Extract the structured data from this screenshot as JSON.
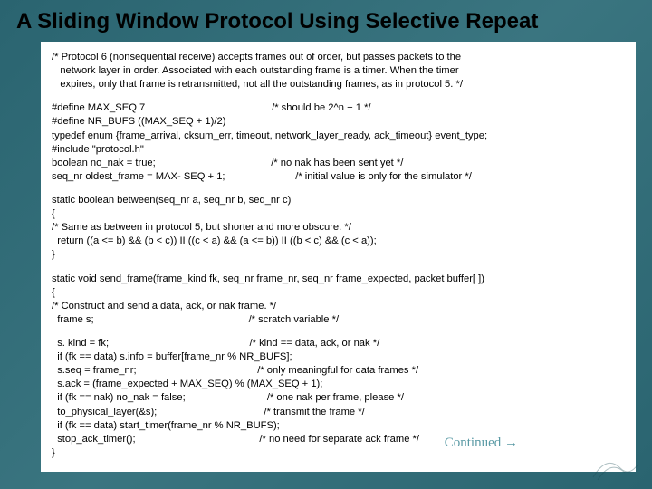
{
  "title": "A Sliding Window Protocol Using Selective Repeat",
  "code": {
    "l1": "/* Protocol 6 (nonsequential receive) accepts frames out of order, but passes packets to the",
    "l2": "   network layer in order. Associated with each outstanding frame is a timer. When the timer",
    "l3": "   expires, only that frame is retransmitted, not all the outstanding frames, as in protocol 5. */",
    "l4": "#define MAX_SEQ 7                                             /* should be 2^n − 1 */",
    "l5": "#define NR_BUFS ((MAX_SEQ + 1)/2)",
    "l6": "typedef enum {frame_arrival, cksum_err, timeout, network_layer_ready, ack_timeout} event_type;",
    "l7": "#include \"protocol.h\"",
    "l8": "boolean no_nak = true;                                         /* no nak has been sent yet */",
    "l9": "seq_nr oldest_frame = MAX- SEQ + 1;                         /* initial value is only for the simulator */",
    "l10": "static boolean between(seq_nr a, seq_nr b, seq_nr c)",
    "l11": "{",
    "l12": "/* Same as between in protocol 5, but shorter and more obscure. */",
    "l13": "  return ((a <= b) && (b < c)) II ((c < a) && (a <= b)) II ((b < c) && (c < a));",
    "l14": "}",
    "l15": "static void send_frame(frame_kind fk, seq_nr frame_nr, seq_nr frame_expected, packet buffer[ ])",
    "l16": "{",
    "l17": "/* Construct and send a data, ack, or nak frame. */",
    "l18": "  frame s;                                                       /* scratch variable */",
    "l19": "  s. kind = fk;                                                  /* kind == data, ack, or nak */",
    "l20": "  if (fk == data) s.info = buffer[frame_nr % NR_BUFS];",
    "l21": "  s.seq = frame_nr;                                           /* only meaningful for data frames */",
    "l22": "  s.ack = (frame_expected + MAX_SEQ) % (MAX_SEQ + 1);",
    "l23": "  if (fk == nak) no_nak = false;                             /* one nak per frame, please */",
    "l24": "  to_physical_layer(&s);                                      /* transmit the frame */",
    "l25": "  if (fk == data) start_timer(frame_nr % NR_BUFS);",
    "l26": "  stop_ack_timer();                                            /* no need for separate ack frame */",
    "l27": "}"
  },
  "continued_label": "Continued",
  "continued_arrow": "→"
}
